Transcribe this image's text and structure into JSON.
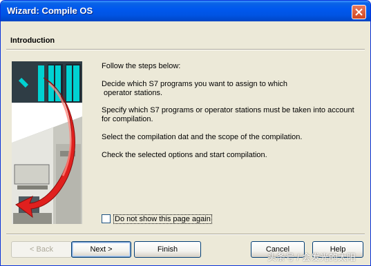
{
  "window": {
    "title": "Wizard: Compile OS"
  },
  "page": {
    "section_title": "Introduction",
    "intro": "Follow the steps below:",
    "step1": "Decide which S7 programs you want to assign to which\n operator stations.",
    "step2": "Specify which S7 programs or operator stations must be taken into account for compilation.",
    "step3": "Select the compilation dat and the scope of the compilation.",
    "step4": "Check the selected options and start compilation."
  },
  "checkbox": {
    "label": "Do not show this page again",
    "checked": false
  },
  "buttons": {
    "back": "< Back",
    "next": "Next >",
    "finish": "Finish",
    "cancel": "Cancel",
    "help": "Help"
  },
  "watermark": "头条号 / 会发光的太阳",
  "colors": {
    "titlebar": "#0054e3",
    "dialog_bg": "#ece9d8",
    "illustration_accent": "#00d2d2",
    "illustration_arrow": "#e0201e"
  }
}
